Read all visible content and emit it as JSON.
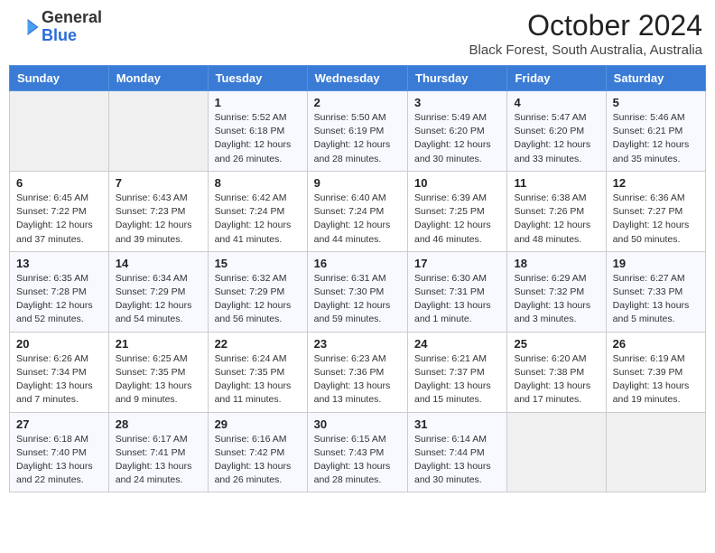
{
  "header": {
    "logo": {
      "general": "General",
      "blue": "Blue"
    },
    "month": "October 2024",
    "location": "Black Forest, South Australia, Australia"
  },
  "weekdays": [
    "Sunday",
    "Monday",
    "Tuesday",
    "Wednesday",
    "Thursday",
    "Friday",
    "Saturday"
  ],
  "weeks": [
    [
      null,
      null,
      {
        "day": 1,
        "sunrise": "5:52 AM",
        "sunset": "6:18 PM",
        "daylight": "12 hours and 26 minutes."
      },
      {
        "day": 2,
        "sunrise": "5:50 AM",
        "sunset": "6:19 PM",
        "daylight": "12 hours and 28 minutes."
      },
      {
        "day": 3,
        "sunrise": "5:49 AM",
        "sunset": "6:20 PM",
        "daylight": "12 hours and 30 minutes."
      },
      {
        "day": 4,
        "sunrise": "5:47 AM",
        "sunset": "6:20 PM",
        "daylight": "12 hours and 33 minutes."
      },
      {
        "day": 5,
        "sunrise": "5:46 AM",
        "sunset": "6:21 PM",
        "daylight": "12 hours and 35 minutes."
      }
    ],
    [
      {
        "day": 6,
        "sunrise": "6:45 AM",
        "sunset": "7:22 PM",
        "daylight": "12 hours and 37 minutes."
      },
      {
        "day": 7,
        "sunrise": "6:43 AM",
        "sunset": "7:23 PM",
        "daylight": "12 hours and 39 minutes."
      },
      {
        "day": 8,
        "sunrise": "6:42 AM",
        "sunset": "7:24 PM",
        "daylight": "12 hours and 41 minutes."
      },
      {
        "day": 9,
        "sunrise": "6:40 AM",
        "sunset": "7:24 PM",
        "daylight": "12 hours and 44 minutes."
      },
      {
        "day": 10,
        "sunrise": "6:39 AM",
        "sunset": "7:25 PM",
        "daylight": "12 hours and 46 minutes."
      },
      {
        "day": 11,
        "sunrise": "6:38 AM",
        "sunset": "7:26 PM",
        "daylight": "12 hours and 48 minutes."
      },
      {
        "day": 12,
        "sunrise": "6:36 AM",
        "sunset": "7:27 PM",
        "daylight": "12 hours and 50 minutes."
      }
    ],
    [
      {
        "day": 13,
        "sunrise": "6:35 AM",
        "sunset": "7:28 PM",
        "daylight": "12 hours and 52 minutes."
      },
      {
        "day": 14,
        "sunrise": "6:34 AM",
        "sunset": "7:29 PM",
        "daylight": "12 hours and 54 minutes."
      },
      {
        "day": 15,
        "sunrise": "6:32 AM",
        "sunset": "7:29 PM",
        "daylight": "12 hours and 56 minutes."
      },
      {
        "day": 16,
        "sunrise": "6:31 AM",
        "sunset": "7:30 PM",
        "daylight": "12 hours and 59 minutes."
      },
      {
        "day": 17,
        "sunrise": "6:30 AM",
        "sunset": "7:31 PM",
        "daylight": "13 hours and 1 minute."
      },
      {
        "day": 18,
        "sunrise": "6:29 AM",
        "sunset": "7:32 PM",
        "daylight": "13 hours and 3 minutes."
      },
      {
        "day": 19,
        "sunrise": "6:27 AM",
        "sunset": "7:33 PM",
        "daylight": "13 hours and 5 minutes."
      }
    ],
    [
      {
        "day": 20,
        "sunrise": "6:26 AM",
        "sunset": "7:34 PM",
        "daylight": "13 hours and 7 minutes."
      },
      {
        "day": 21,
        "sunrise": "6:25 AM",
        "sunset": "7:35 PM",
        "daylight": "13 hours and 9 minutes."
      },
      {
        "day": 22,
        "sunrise": "6:24 AM",
        "sunset": "7:35 PM",
        "daylight": "13 hours and 11 minutes."
      },
      {
        "day": 23,
        "sunrise": "6:23 AM",
        "sunset": "7:36 PM",
        "daylight": "13 hours and 13 minutes."
      },
      {
        "day": 24,
        "sunrise": "6:21 AM",
        "sunset": "7:37 PM",
        "daylight": "13 hours and 15 minutes."
      },
      {
        "day": 25,
        "sunrise": "6:20 AM",
        "sunset": "7:38 PM",
        "daylight": "13 hours and 17 minutes."
      },
      {
        "day": 26,
        "sunrise": "6:19 AM",
        "sunset": "7:39 PM",
        "daylight": "13 hours and 19 minutes."
      }
    ],
    [
      {
        "day": 27,
        "sunrise": "6:18 AM",
        "sunset": "7:40 PM",
        "daylight": "13 hours and 22 minutes."
      },
      {
        "day": 28,
        "sunrise": "6:17 AM",
        "sunset": "7:41 PM",
        "daylight": "13 hours and 24 minutes."
      },
      {
        "day": 29,
        "sunrise": "6:16 AM",
        "sunset": "7:42 PM",
        "daylight": "13 hours and 26 minutes."
      },
      {
        "day": 30,
        "sunrise": "6:15 AM",
        "sunset": "7:43 PM",
        "daylight": "13 hours and 28 minutes."
      },
      {
        "day": 31,
        "sunrise": "6:14 AM",
        "sunset": "7:44 PM",
        "daylight": "13 hours and 30 minutes."
      },
      null,
      null
    ]
  ],
  "labels": {
    "sunrise_prefix": "Sunrise: ",
    "sunset_prefix": "Sunset: ",
    "daylight_prefix": "Daylight: "
  }
}
